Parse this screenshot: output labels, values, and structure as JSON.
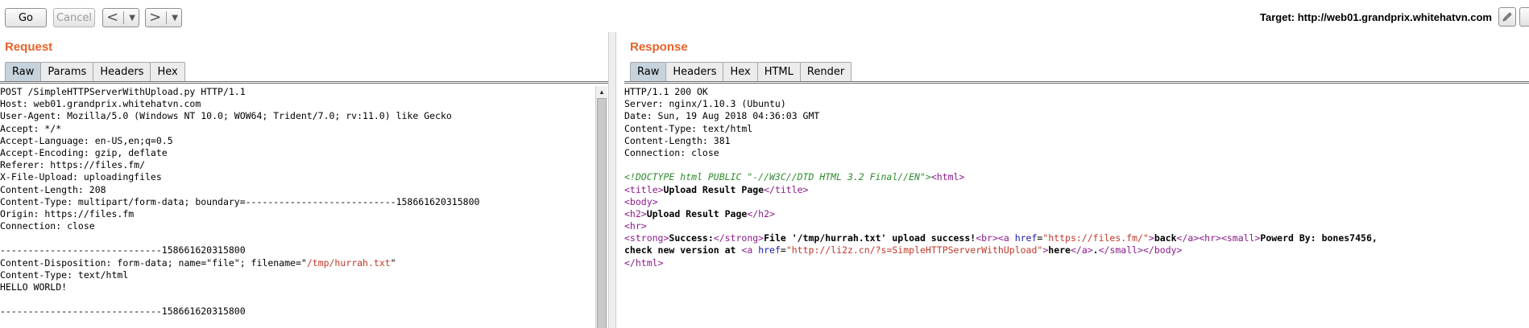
{
  "toolbar": {
    "go_label": "Go",
    "cancel_label": "Cancel",
    "back_glyph": "<",
    "forward_glyph": ">",
    "dropdown_glyph": "▼",
    "target_label": "Target: http://web01.grandprix.whitehatvn.com",
    "edit_icon": "pencil-icon"
  },
  "request": {
    "title": "Request",
    "tabs": [
      "Raw",
      "Params",
      "Headers",
      "Hex"
    ],
    "active_tab": "Raw",
    "lines": [
      "POST /SimpleHTTPServerWithUpload.py HTTP/1.1",
      "Host: web01.grandprix.whitehatvn.com",
      "User-Agent: Mozilla/5.0 (Windows NT 10.0; WOW64; Trident/7.0; rv:11.0) like Gecko",
      "Accept: */*",
      "Accept-Language: en-US,en;q=0.5",
      "Accept-Encoding: gzip, deflate",
      "Referer: https://files.fm/",
      "X-File-Upload: uploadingfiles",
      "Content-Length: 208",
      "Content-Type: multipart/form-data; boundary=---------------------------158661620315800",
      "Origin: https://files.fm",
      "Connection: close",
      "",
      "-----------------------------158661620315800",
      "Content-Disposition: form-data; name=\"file\"; filename=\"/tmp/hurrah.txt\"",
      "Content-Type: text/html",
      "HELLO WORLD!",
      "",
      "-----------------------------158661620315800"
    ],
    "disposition_prefix": "Content-Disposition: form-data; name=\"file\"; filename=\"",
    "disposition_filename": "/tmp/hurrah.txt",
    "disposition_suffix": "\""
  },
  "response": {
    "title": "Response",
    "tabs": [
      "Raw",
      "Headers",
      "Hex",
      "HTML",
      "Render"
    ],
    "active_tab": "Raw",
    "header_lines": [
      "HTTP/1.1 200 OK",
      "Server: nginx/1.10.3 (Ubuntu)",
      "Date: Sun, 19 Aug 2018 04:36:03 GMT",
      "Content-Type: text/html",
      "Content-Length: 381",
      "Connection: close",
      ""
    ],
    "doctype": "<!DOCTYPE html PUBLIC \"-//W3C//DTD HTML 3.2 Final//EN\">",
    "html_open": "<html>",
    "title_open": "<title>",
    "title_text": "Upload Result Page",
    "title_close": "</title>",
    "body_open": "<body>",
    "h2_open": "<h2>",
    "h2_text": "Upload Result Page",
    "h2_close": "</h2>",
    "hr": "<hr>",
    "strong_open": "<strong>",
    "strong_text": "Success:",
    "strong_close": "</strong>",
    "file_text": "File '/tmp/hurrah.txt' upload success!",
    "br": "<br>",
    "a_open": "<a ",
    "href_attr": "href",
    "eq": "=",
    "href1": "\"https://files.fm/\"",
    "gt": ">",
    "back_text": "back",
    "a_close": "</a>",
    "hr2": "<hr>",
    "small_open": "<small>",
    "powered_text": "Powerd By: bones7456,",
    "check_text": "check new version at ",
    "href2": "\"http://li2z.cn/?s=SimpleHTTPServerWithUpload\"",
    "here_text": "here",
    "a_close2": "</a>",
    "dot": ".",
    "small_close": "</small>",
    "body_close": "</body>",
    "html_close": "</html>"
  }
}
